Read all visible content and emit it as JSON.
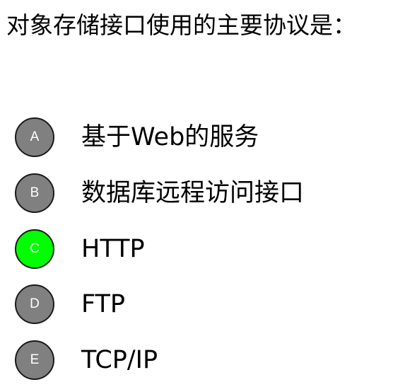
{
  "question": {
    "text": "对象存储接口使用的主要协议是："
  },
  "options": [
    {
      "letter": "A",
      "text": "基于Web的服务"
    },
    {
      "letter": "B",
      "text": "数据库远程访问接口"
    },
    {
      "letter": "C",
      "text": "HTTP"
    },
    {
      "letter": "D",
      "text": "FTP"
    },
    {
      "letter": "E",
      "text": "TCP/IP"
    }
  ],
  "selected_letter": "C",
  "colors": {
    "badge_default": "#808080",
    "badge_selected": "#00ff00",
    "badge_border": "#1a1a1a",
    "text": "#000000",
    "background": "#ffffff"
  }
}
